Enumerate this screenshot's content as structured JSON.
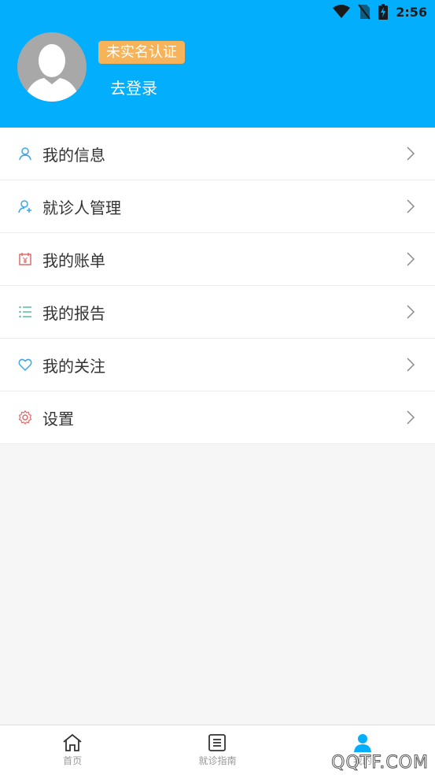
{
  "status_bar": {
    "time": "2:56"
  },
  "profile": {
    "verify_badge": "未实名认证",
    "login_label": "去登录"
  },
  "menu": {
    "items": [
      {
        "label": "我的信息",
        "icon": "user-icon",
        "color": "#3aa7e6"
      },
      {
        "label": "就诊人管理",
        "icon": "patient-manage-icon",
        "color": "#3aa7e6"
      },
      {
        "label": "我的账单",
        "icon": "bill-icon",
        "color": "#e06b6b"
      },
      {
        "label": "我的报告",
        "icon": "report-list-icon",
        "color": "#4cc29a"
      },
      {
        "label": "我的关注",
        "icon": "heart-icon",
        "color": "#3aa7e6"
      },
      {
        "label": "设置",
        "icon": "gear-icon",
        "color": "#e06b6b"
      }
    ]
  },
  "tabbar": {
    "tabs": [
      {
        "label": "首页",
        "icon": "home-icon"
      },
      {
        "label": "就诊指南",
        "icon": "guide-icon"
      },
      {
        "label": "我的",
        "icon": "profile-icon",
        "active": true
      }
    ]
  },
  "watermark": "QQTF.COM",
  "colors": {
    "header": "#03aefc",
    "badge": "#f6b35a",
    "active_tab": "#03aefc"
  }
}
